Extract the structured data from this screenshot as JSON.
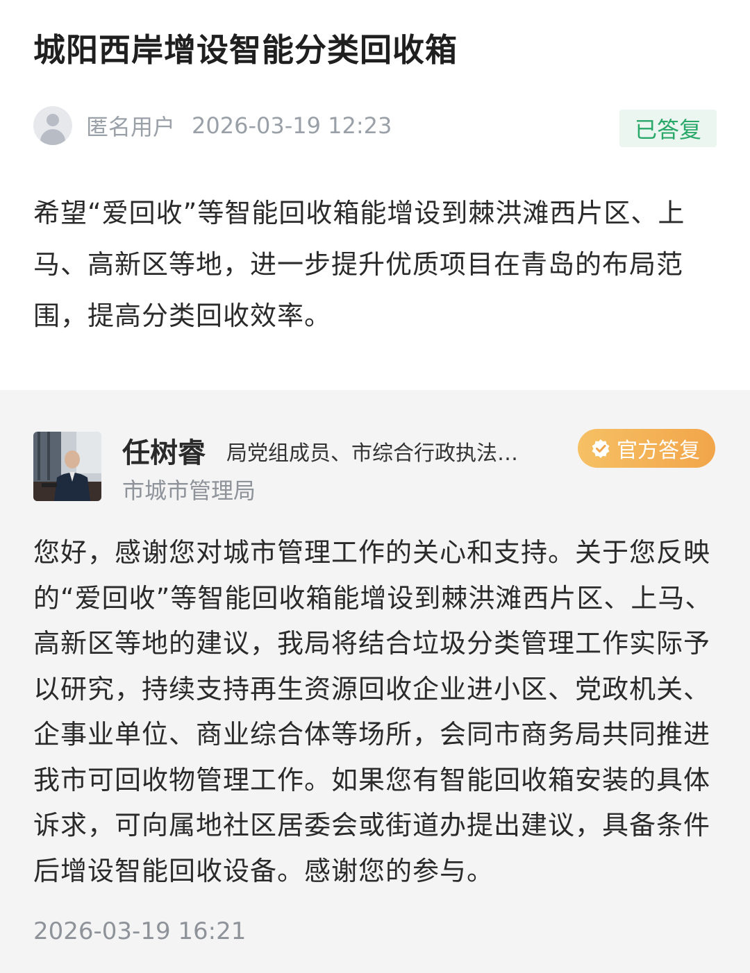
{
  "post": {
    "title": "城阳西岸增设智能分类回收箱",
    "author": "匿名用户",
    "time": "2026-03-19 12:23",
    "status": "已答复",
    "content": "希望“爱回收”等智能回收箱能增设到棘洪滩西片区、上马、高新区等地，进一步提升优质项目在青岛的布局范围，提高分类回收效率。"
  },
  "reply": {
    "name": "任树睿",
    "title": "局党组成员、市综合行政执法…",
    "badge": "官方答复",
    "department": "市城市管理局",
    "content": "您好，感谢您对城市管理工作的关心和支持。关于您反映的“爱回收”等智能回收箱能增设到棘洪滩西片区、上马、高新区等地的建议，我局将结合垃圾分类管理工作实际予以研究，持续支持再生资源回收企业进小区、党政机关、企事业单位、商业综合体等场所，会同市商务局共同推进我市可回收物管理工作。如果您有智能回收箱安装的具体诉求，可向属地社区居委会或街道办提出建议，具备条件后增设智能回收设备。感谢您的参与。",
    "time": "2026-03-19 16:21"
  },
  "colors": {
    "status_green": "#2aa86a",
    "badge_orange": "#f2a54a",
    "reply_bg": "#f4f4f5"
  },
  "icons": {
    "anon_avatar": "user-silhouette-icon",
    "official_badge": "verified-check-icon"
  }
}
